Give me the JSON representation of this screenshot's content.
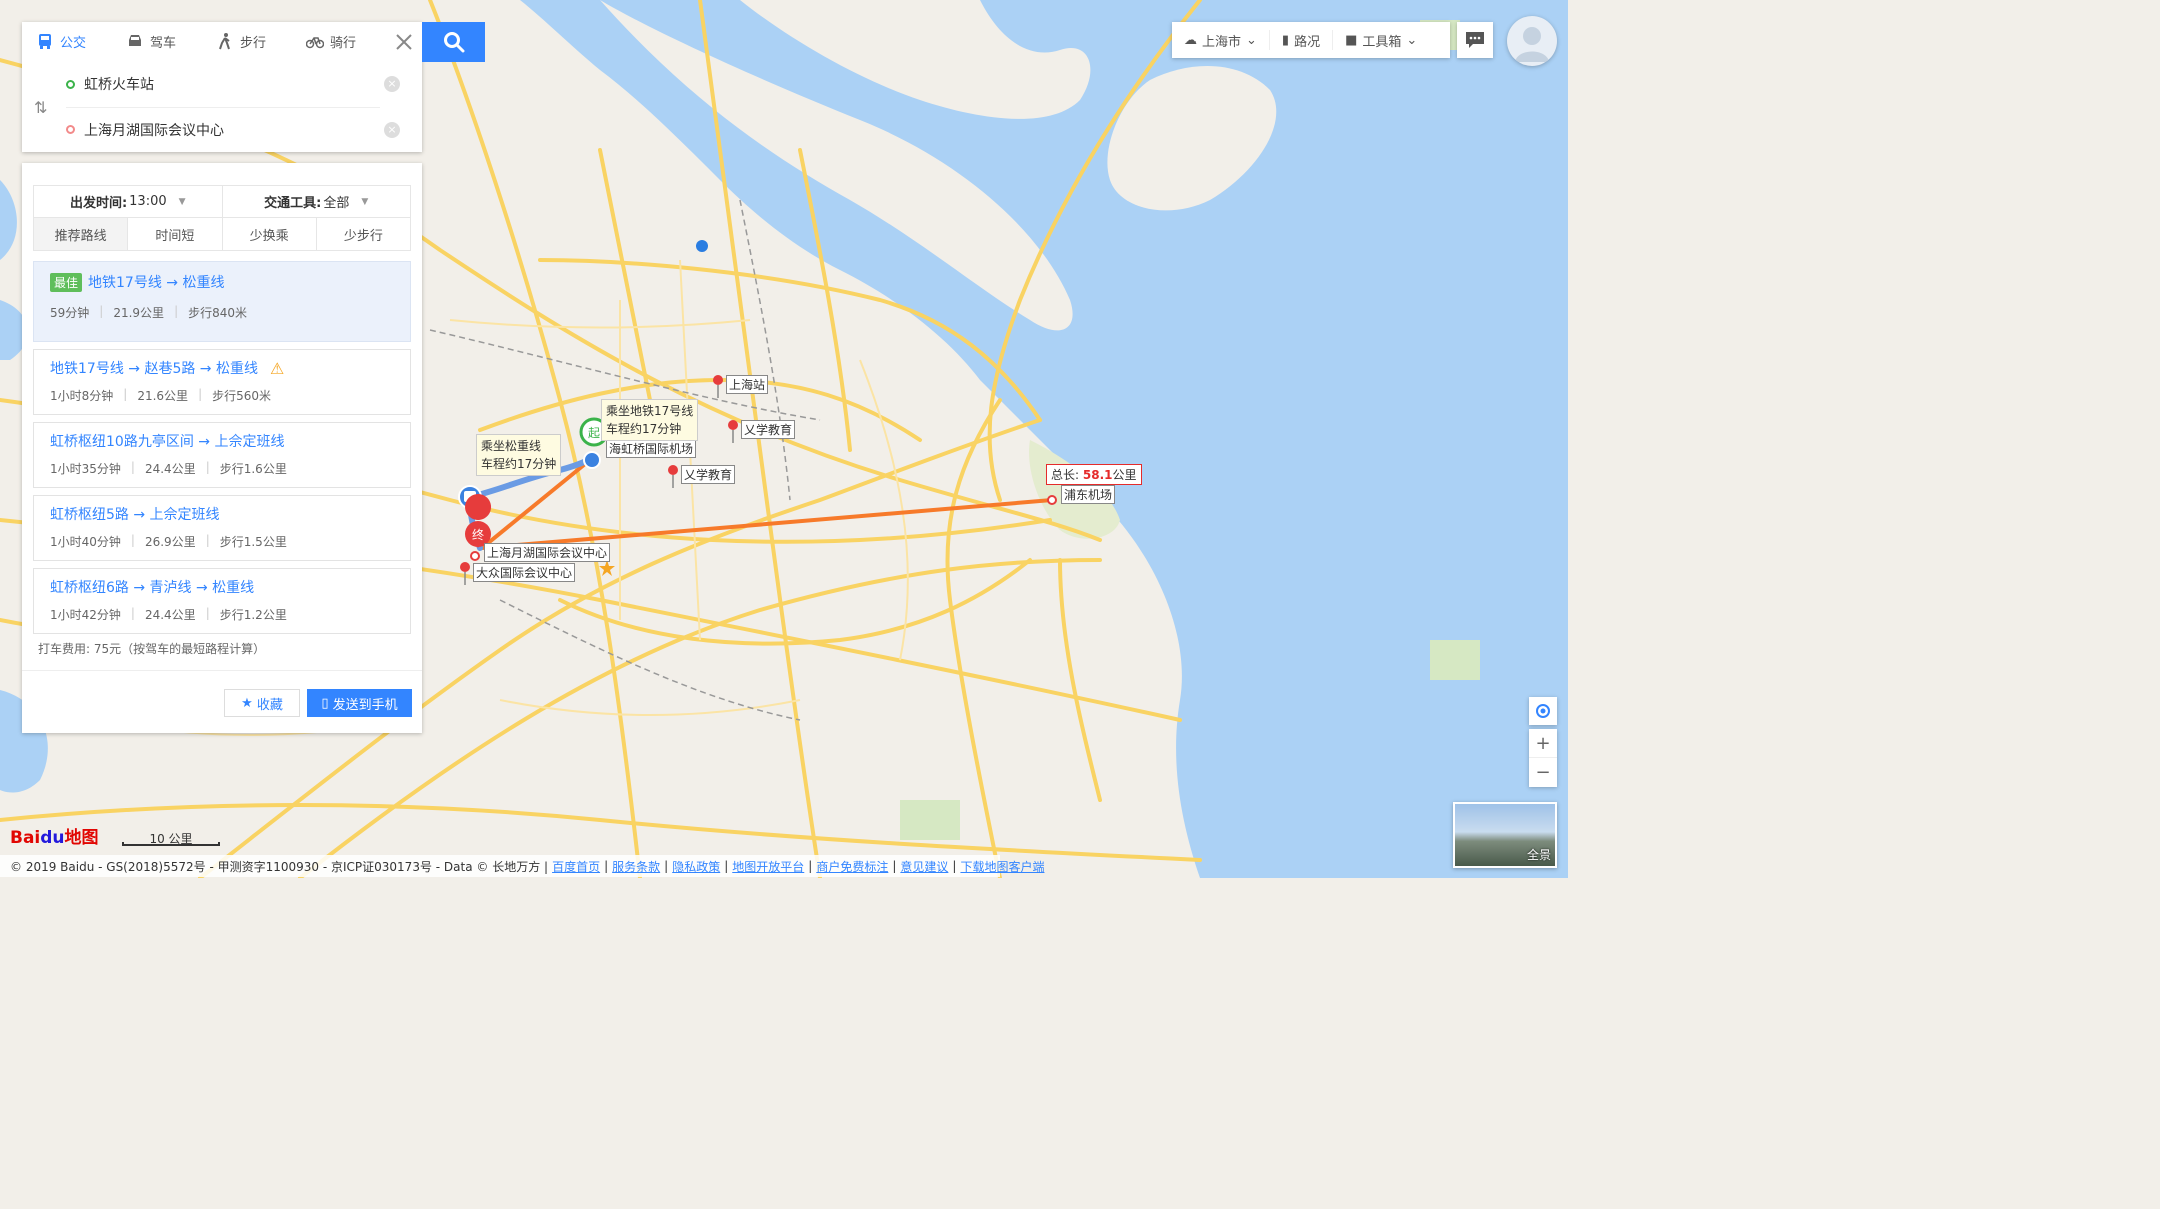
{
  "modes": [
    {
      "label": "公交",
      "icon": "bus-icon",
      "active": true
    },
    {
      "label": "驾车",
      "icon": "car-icon",
      "active": false
    },
    {
      "label": "步行",
      "icon": "walk-icon",
      "active": false
    },
    {
      "label": "骑行",
      "icon": "bike-icon",
      "active": false
    }
  ],
  "route": {
    "start": "虹桥火车站",
    "end": "上海月湖国际会议中心"
  },
  "options": {
    "depart_label": "出发时间:",
    "depart_value": "13:00",
    "tool_label": "交通工具:",
    "tool_value": "全部"
  },
  "sorts": [
    "推荐路线",
    "时间短",
    "少换乘",
    "少步行"
  ],
  "plans": [
    {
      "badge": "最佳",
      "title": "地铁17号线 → 松重线",
      "time": "59分钟",
      "dist": "21.9公里",
      "walk": "步行840米",
      "warn": false
    },
    {
      "badge": "",
      "title": "地铁17号线 → 赵巷5路 → 松重线",
      "time": "1小时8分钟",
      "dist": "21.6公里",
      "walk": "步行560米",
      "warn": true
    },
    {
      "badge": "",
      "title": "虹桥枢纽10路九亭区间 → 上佘定班线",
      "time": "1小时35分钟",
      "dist": "24.4公里",
      "walk": "步行1.6公里",
      "warn": false
    },
    {
      "badge": "",
      "title": "虹桥枢纽5路 → 上佘定班线",
      "time": "1小时40分钟",
      "dist": "26.9公里",
      "walk": "步行1.5公里",
      "warn": false
    },
    {
      "badge": "",
      "title": "虹桥枢纽6路 → 青泸线 → 松重线",
      "time": "1小时42分钟",
      "dist": "24.4公里",
      "walk": "步行1.2公里",
      "warn": false
    }
  ],
  "taxi": "打车费用: 75元（按驾车的最短路程计算）",
  "buttons": {
    "fav": "收藏",
    "send": "发送到手机"
  },
  "toolbar": {
    "city": "上海市",
    "traffic": "路况",
    "tools": "工具箱"
  },
  "map_labels": {
    "shanghai_station": "上海站",
    "yixue1": "乂学教育",
    "yixue2": "乂学教育",
    "hongqiao_airport": "海虹桥国际机场",
    "yuehu": "上海月湖国际会议中心",
    "dazhong": "大众国际会议中心",
    "pudong_airport": "浦东机场",
    "tip_metro_line1": "乘坐地铁17号线",
    "tip_metro_line2": "车程约17分钟",
    "tip_bus_line1": "乘坐松重线",
    "tip_bus_line2": "车程约17分钟",
    "total_prefix": "总长:",
    "total_value": "58.1",
    "total_unit": "公里",
    "end_marker": "终",
    "start_marker": "起"
  },
  "scale": "10 公里",
  "logo": {
    "text1": "Bai",
    "text2": "du",
    "text3": "地图"
  },
  "pano_label": "全景",
  "footer": {
    "copyright": "© 2019 Baidu - GS(2018)5572号 - 甲测资字1100930 - 京ICP证030173号 - Data © 长地万方 |",
    "links": [
      "百度首页",
      "服务条款",
      "隐私政策",
      "地图开放平台",
      "商户免费标注",
      "意见建议",
      "下载地图客户端"
    ]
  },
  "colors": {
    "accent": "#3385ff",
    "route": "#f77a2a",
    "water": "#abd1f5",
    "land": "#f2efe9",
    "road": "#f9d363"
  }
}
